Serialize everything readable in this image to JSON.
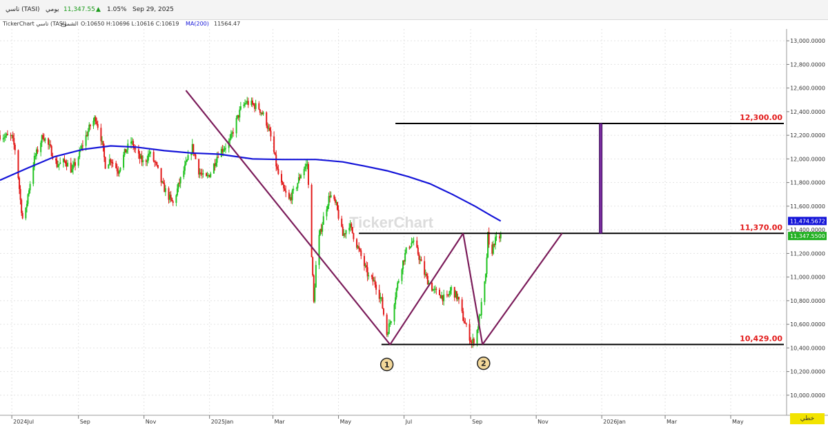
{
  "header": {
    "symbol": "تاسي (TASI)",
    "interval": "يومي",
    "last": "11,347.55",
    "change_pct": "1.05%",
    "date": "Sep 29, 2025",
    "up_color": "#1a9a1a"
  },
  "info_bar": {
    "source": "TickerChart تاسي (TASI)",
    "candles_label": "الشموع",
    "ohlc": "O:10650  H:10696  L:10616  C:10619",
    "ma_label": "MA(200)",
    "ma_value": "11564.47"
  },
  "watermark": "TickerChart",
  "mode_badge": "خطي",
  "chart_data": {
    "type": "candlestick",
    "x_tick_labels": [
      "2024Jul",
      "Sep",
      "Nov",
      "2025Jan",
      "Mar",
      "May",
      "Jul",
      "Sep",
      "Nov",
      "2026Jan",
      "Mar",
      "May"
    ],
    "x_tick_dates": [
      "2024-07-01",
      "2024-09-01",
      "2024-11-01",
      "2025-01-01",
      "2025-03-01",
      "2025-05-01",
      "2025-07-01",
      "2025-09-01",
      "2025-11-01",
      "2026-01-01",
      "2026-03-01",
      "2026-05-01"
    ],
    "y_ticks": [
      10000,
      10200,
      10400,
      10600,
      10800,
      11000,
      11200,
      11400,
      11600,
      11800,
      12000,
      12200,
      12400,
      12600,
      12800,
      13000
    ],
    "y_tick_labels": [
      "10,000.0000",
      "10,200.0000",
      "10,400.0000",
      "10,600.0000",
      "10,800.0000",
      "11,000.0000",
      "11,200.0000",
      "11,400.0000",
      "11,600.0000",
      "11,800.0000",
      "12,000.0000",
      "12,200.0000",
      "12,400.0000",
      "12,600.0000",
      "12,800.0000",
      "13,000.0000"
    ],
    "ylim": [
      9830,
      13100
    ],
    "xlim": [
      "2024-06-20",
      "2026-06-22"
    ],
    "price_close_path": [
      [
        "2024-06-20",
        12200
      ],
      [
        "2024-07-01",
        12180
      ],
      [
        "2024-07-05",
        12050
      ],
      [
        "2024-07-09",
        11650
      ],
      [
        "2024-07-12",
        11420
      ],
      [
        "2024-07-16",
        11700
      ],
      [
        "2024-07-22",
        12000
      ],
      [
        "2024-07-30",
        12200
      ],
      [
        "2024-08-06",
        12080
      ],
      [
        "2024-08-12",
        11950
      ],
      [
        "2024-08-20",
        11980
      ],
      [
        "2024-08-26",
        11900
      ],
      [
        "2024-09-01",
        12020
      ],
      [
        "2024-09-06",
        12150
      ],
      [
        "2024-09-12",
        12280
      ],
      [
        "2024-09-17",
        12350
      ],
      [
        "2024-09-22",
        12180
      ],
      [
        "2024-09-26",
        11950
      ],
      [
        "2024-10-01",
        12000
      ],
      [
        "2024-10-08",
        11900
      ],
      [
        "2024-10-14",
        12050
      ],
      [
        "2024-10-20",
        12150
      ],
      [
        "2024-10-26",
        12030
      ],
      [
        "2024-11-01",
        11960
      ],
      [
        "2024-11-06",
        12050
      ],
      [
        "2024-11-12",
        11950
      ],
      [
        "2024-11-18",
        11780
      ],
      [
        "2024-11-24",
        11680
      ],
      [
        "2024-11-28",
        11620
      ],
      [
        "2024-12-04",
        11800
      ],
      [
        "2024-12-10",
        11950
      ],
      [
        "2024-12-16",
        12100
      ],
      [
        "2024-12-22",
        11900
      ],
      [
        "2024-12-28",
        11820
      ],
      [
        "2025-01-03",
        11900
      ],
      [
        "2025-01-09",
        12050
      ],
      [
        "2025-01-15",
        12100
      ],
      [
        "2025-01-20",
        12150
      ],
      [
        "2025-01-25",
        12300
      ],
      [
        "2025-01-30",
        12420
      ],
      [
        "2025-02-04",
        12480
      ],
      [
        "2025-02-10",
        12460
      ],
      [
        "2025-02-16",
        12430
      ],
      [
        "2025-02-22",
        12340
      ],
      [
        "2025-02-28",
        12150
      ],
      [
        "2025-03-05",
        11900
      ],
      [
        "2025-03-10",
        11750
      ],
      [
        "2025-03-16",
        11650
      ],
      [
        "2025-03-22",
        11750
      ],
      [
        "2025-03-28",
        11900
      ],
      [
        "2025-04-02",
        11960
      ],
      [
        "2025-04-06",
        11200
      ],
      [
        "2025-04-08",
        10780
      ],
      [
        "2025-04-11",
        11250
      ],
      [
        "2025-04-17",
        11500
      ],
      [
        "2025-04-23",
        11700
      ],
      [
        "2025-04-29",
        11600
      ],
      [
        "2025-05-05",
        11350
      ],
      [
        "2025-05-11",
        11450
      ],
      [
        "2025-05-17",
        11300
      ],
      [
        "2025-05-23",
        11150
      ],
      [
        "2025-05-29",
        11000
      ],
      [
        "2025-06-04",
        10950
      ],
      [
        "2025-06-10",
        10800
      ],
      [
        "2025-06-15",
        10520
      ],
      [
        "2025-06-19",
        10650
      ],
      [
        "2025-06-24",
        10900
      ],
      [
        "2025-06-29",
        11100
      ],
      [
        "2025-07-04",
        11250
      ],
      [
        "2025-07-09",
        11300
      ],
      [
        "2025-07-14",
        11200
      ],
      [
        "2025-07-19",
        11050
      ],
      [
        "2025-07-24",
        10950
      ],
      [
        "2025-07-29",
        10880
      ],
      [
        "2025-08-04",
        10850
      ],
      [
        "2025-08-09",
        10800
      ],
      [
        "2025-08-14",
        10900
      ],
      [
        "2025-08-20",
        10820
      ],
      [
        "2025-08-25",
        10650
      ],
      [
        "2025-08-29",
        10550
      ],
      [
        "2025-09-02",
        10440
      ],
      [
        "2025-09-06",
        10500
      ],
      [
        "2025-09-10",
        10700
      ],
      [
        "2025-09-15",
        11000
      ],
      [
        "2025-09-17",
        11350
      ],
      [
        "2025-09-19",
        11150
      ],
      [
        "2025-09-23",
        11300
      ],
      [
        "2025-09-29",
        11347.55
      ]
    ],
    "ma_series": {
      "name": "MA(200)",
      "color": "#1414d8",
      "points": [
        [
          "2024-06-20",
          11820
        ],
        [
          "2024-07-15",
          11920
        ],
        [
          "2024-08-10",
          12020
        ],
        [
          "2024-09-05",
          12080
        ],
        [
          "2024-10-01",
          12110
        ],
        [
          "2024-10-25",
          12100
        ],
        [
          "2024-11-20",
          12070
        ],
        [
          "2024-12-15",
          12050
        ],
        [
          "2025-01-10",
          12040
        ],
        [
          "2025-02-10",
          12000
        ],
        [
          "2025-03-10",
          11995
        ],
        [
          "2025-04-10",
          11995
        ],
        [
          "2025-05-05",
          11975
        ],
        [
          "2025-05-25",
          11940
        ],
        [
          "2025-06-15",
          11900
        ],
        [
          "2025-07-05",
          11850
        ],
        [
          "2025-07-25",
          11790
        ],
        [
          "2025-08-15",
          11700
        ],
        [
          "2025-09-05",
          11600
        ],
        [
          "2025-09-20",
          11520
        ],
        [
          "2025-09-29",
          11474.5672
        ]
      ]
    },
    "horizontal_levels": [
      {
        "value": 12300,
        "label": "12,300.00",
        "from": "2025-06-23",
        "to": "2026-06-20"
      },
      {
        "value": 11370,
        "label": "11,370.00",
        "from": "2025-05-20",
        "to": "2026-06-20"
      },
      {
        "value": 10429,
        "label": "10,429.00",
        "from": "2025-06-10",
        "to": "2026-06-20"
      }
    ],
    "pattern_lines": [
      {
        "x": [
          "2024-12-10",
          "2025-06-18"
        ],
        "y": [
          12580,
          10429
        ]
      },
      {
        "x": [
          "2025-06-18",
          "2025-08-25"
        ],
        "y": [
          10429,
          11370
        ]
      },
      {
        "x": [
          "2025-08-25",
          "2025-09-12"
        ],
        "y": [
          11370,
          10429
        ]
      },
      {
        "x": [
          "2025-09-12",
          "2025-11-25"
        ],
        "y": [
          10429,
          11370
        ]
      }
    ],
    "target_bar": {
      "x": "2025-12-31",
      "from": 11370,
      "to": 12300
    },
    "markers": [
      {
        "label": "1",
        "x": "2025-06-15",
        "y": 10260
      },
      {
        "label": "2",
        "x": "2025-09-13",
        "y": 10270
      }
    ],
    "price_badges": [
      {
        "value": 11474.5672,
        "label": "11,474.5672",
        "color": "#1414d8"
      },
      {
        "value": 11347.55,
        "label": "11,347.5500",
        "color": "#22b022"
      }
    ],
    "colors": {
      "up": "#22c322",
      "down": "#e21a1a",
      "pattern": "#7b1c5a",
      "level_label": "#e21a1a",
      "level_line": "#000000"
    }
  }
}
